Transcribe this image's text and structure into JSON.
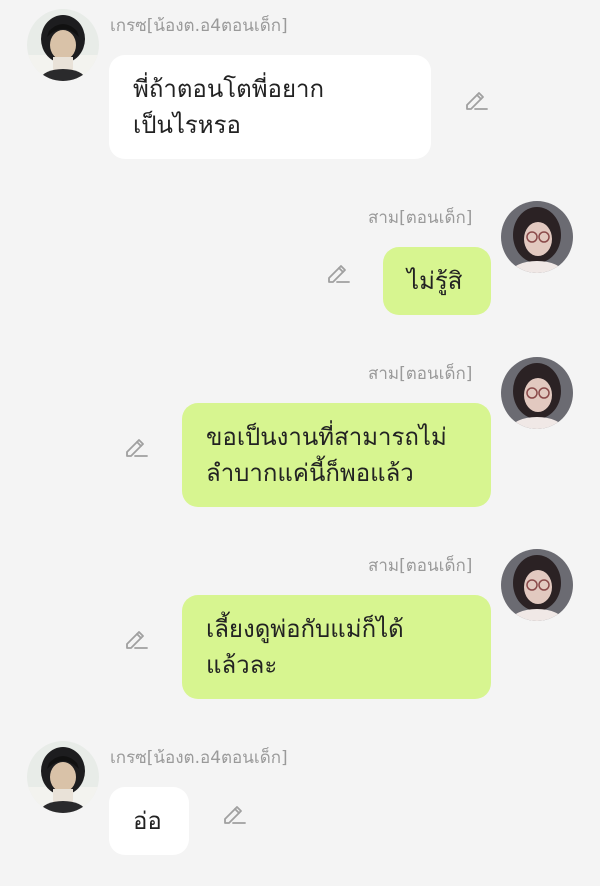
{
  "messages": [
    {
      "side": "left",
      "sender": "เกรซ[น้องต.อ4ตอนเด็ก]",
      "lines": [
        "พี่ถ้าตอนโตพี่อยาก",
        "เป็นไรหรอ"
      ],
      "avatar_icon": "avatar-dark-hair-girl"
    },
    {
      "side": "right",
      "sender": "สาม[ตอนเด็ก]",
      "lines": [
        "ไม่รู้สิ"
      ],
      "avatar_icon": "avatar-glasses-girl"
    },
    {
      "side": "right",
      "sender": "สาม[ตอนเด็ก]",
      "lines": [
        "ขอเป็นงานที่สามารถไม่",
        "ลำบากแค่นี้ก็พอแล้ว"
      ],
      "avatar_icon": "avatar-glasses-girl"
    },
    {
      "side": "right",
      "sender": "สาม[ตอนเด็ก]",
      "lines": [
        "เลี้ยงดูพ่อกับแม่ก็ได้",
        "แล้วละ"
      ],
      "avatar_icon": "avatar-glasses-girl"
    },
    {
      "side": "left",
      "sender": "เกรซ[น้องต.อ4ตอนเด็ก]",
      "lines": [
        "อ่อ"
      ],
      "avatar_icon": "avatar-dark-hair-girl"
    }
  ],
  "colors": {
    "background": "#f4f4f4",
    "left_bubble": "#ffffff",
    "right_bubble": "#d7f590",
    "name_text": "#9a9a9a",
    "edit_icon": "#a0a0a0"
  },
  "edit_icon": "pencil-edit-icon"
}
